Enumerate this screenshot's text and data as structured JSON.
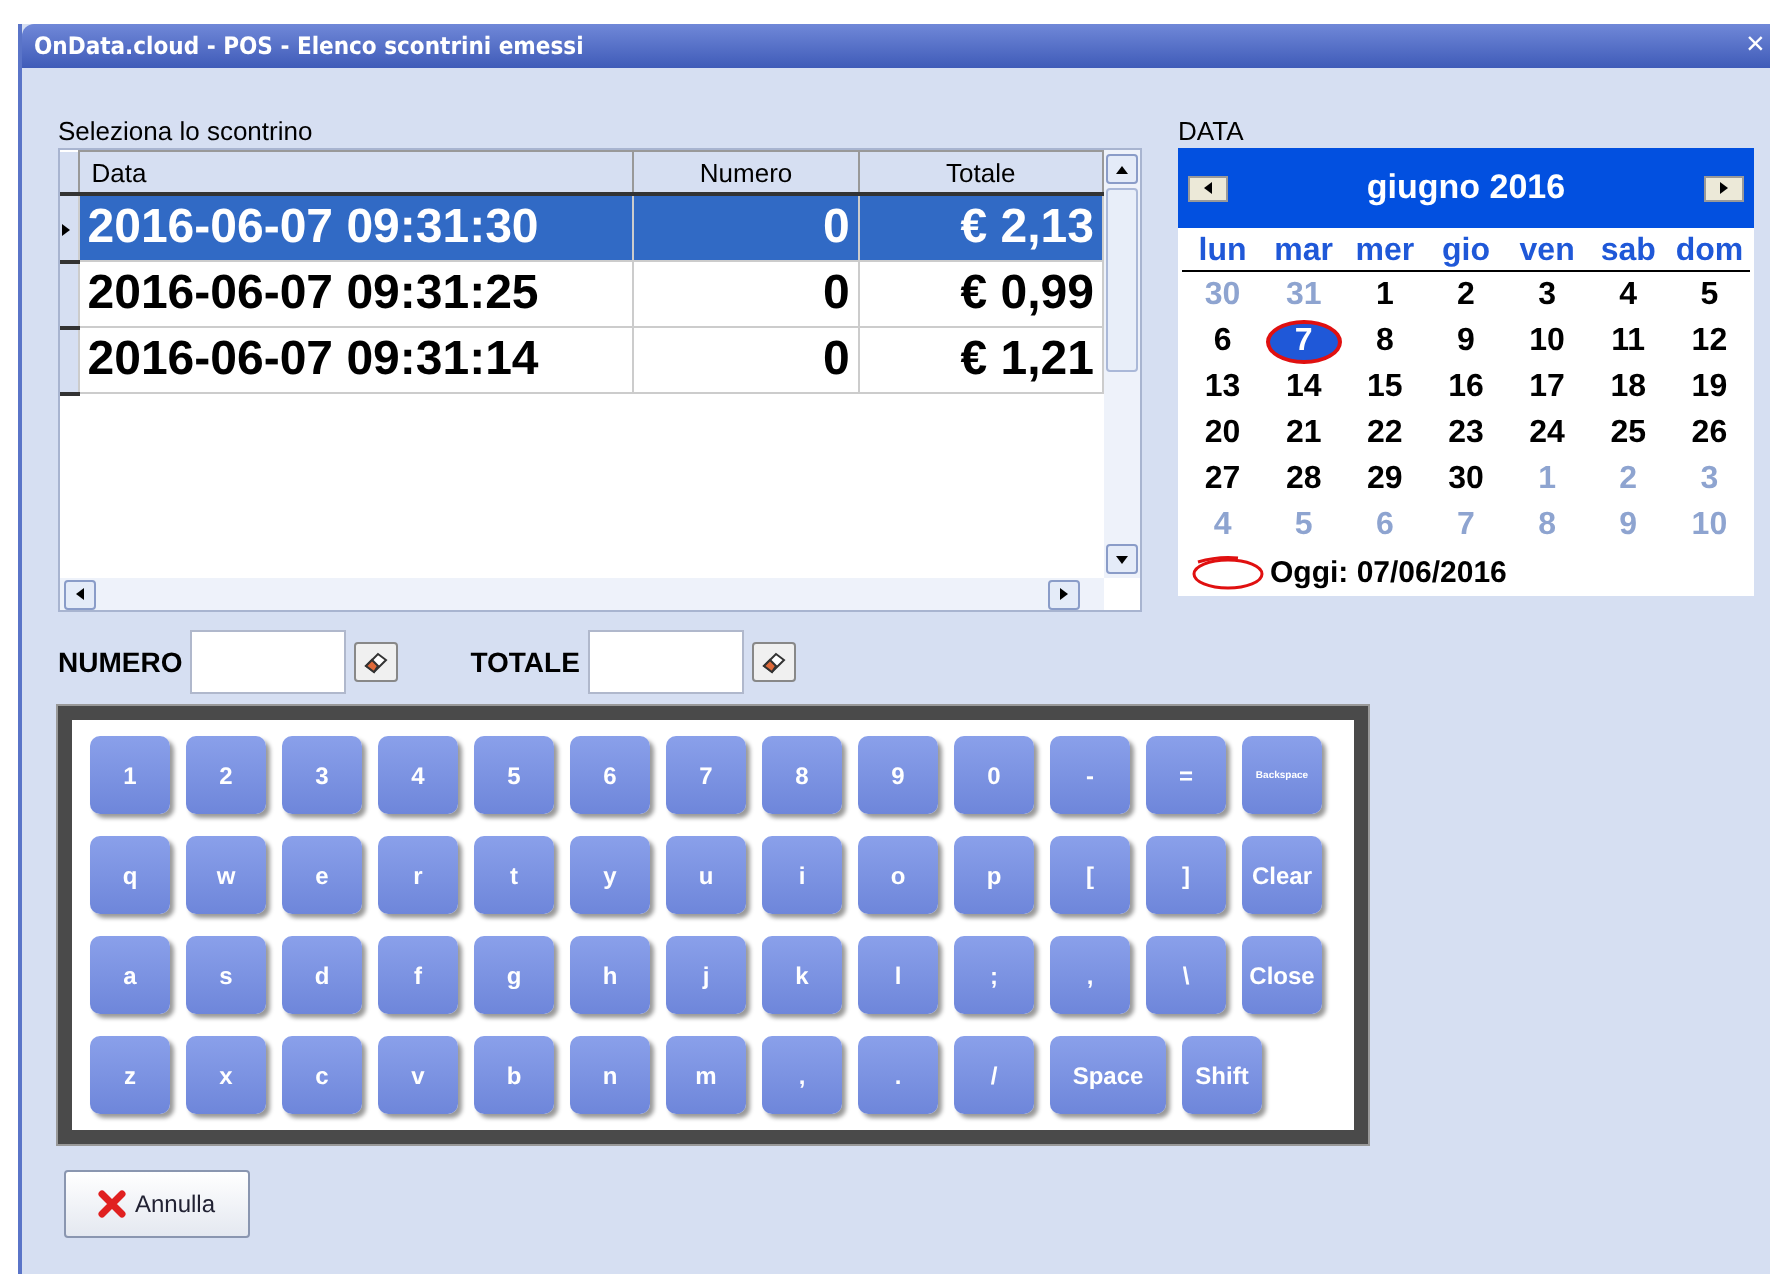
{
  "window": {
    "title": "OnData.cloud - POS - Elenco scontrini emessi",
    "close": "×"
  },
  "receipts": {
    "label": "Seleziona lo scontrino",
    "columns": [
      "Data",
      "Numero",
      "Totale"
    ],
    "rows": [
      {
        "data": "2016-06-07 09:31:30",
        "numero": "0",
        "totale": "€ 2,13",
        "selected": true
      },
      {
        "data": "2016-06-07 09:31:25",
        "numero": "0",
        "totale": "€ 0,99",
        "selected": false
      },
      {
        "data": "2016-06-07 09:31:14",
        "numero": "0",
        "totale": "€ 1,21",
        "selected": false
      }
    ]
  },
  "calendar": {
    "label": "DATA",
    "month": "giugno 2016",
    "weekdays": [
      "lun",
      "mar",
      "mer",
      "gio",
      "ven",
      "sab",
      "dom"
    ],
    "weeks": [
      [
        {
          "label": "30",
          "outside": true,
          "selected": false
        },
        {
          "label": "31",
          "outside": true,
          "selected": false
        },
        {
          "label": "1",
          "outside": false,
          "selected": false
        },
        {
          "label": "2",
          "outside": false,
          "selected": false
        },
        {
          "label": "3",
          "outside": false,
          "selected": false
        },
        {
          "label": "4",
          "outside": false,
          "selected": false
        },
        {
          "label": "5",
          "outside": false,
          "selected": false
        }
      ],
      [
        {
          "label": "6",
          "outside": false,
          "selected": false
        },
        {
          "label": "7",
          "outside": false,
          "selected": true
        },
        {
          "label": "8",
          "outside": false,
          "selected": false
        },
        {
          "label": "9",
          "outside": false,
          "selected": false
        },
        {
          "label": "10",
          "outside": false,
          "selected": false
        },
        {
          "label": "11",
          "outside": false,
          "selected": false
        },
        {
          "label": "12",
          "outside": false,
          "selected": false
        }
      ],
      [
        {
          "label": "13",
          "outside": false,
          "selected": false
        },
        {
          "label": "14",
          "outside": false,
          "selected": false
        },
        {
          "label": "15",
          "outside": false,
          "selected": false
        },
        {
          "label": "16",
          "outside": false,
          "selected": false
        },
        {
          "label": "17",
          "outside": false,
          "selected": false
        },
        {
          "label": "18",
          "outside": false,
          "selected": false
        },
        {
          "label": "19",
          "outside": false,
          "selected": false
        }
      ],
      [
        {
          "label": "20",
          "outside": false,
          "selected": false
        },
        {
          "label": "21",
          "outside": false,
          "selected": false
        },
        {
          "label": "22",
          "outside": false,
          "selected": false
        },
        {
          "label": "23",
          "outside": false,
          "selected": false
        },
        {
          "label": "24",
          "outside": false,
          "selected": false
        },
        {
          "label": "25",
          "outside": false,
          "selected": false
        },
        {
          "label": "26",
          "outside": false,
          "selected": false
        }
      ],
      [
        {
          "label": "27",
          "outside": false,
          "selected": false
        },
        {
          "label": "28",
          "outside": false,
          "selected": false
        },
        {
          "label": "29",
          "outside": false,
          "selected": false
        },
        {
          "label": "30",
          "outside": false,
          "selected": false
        },
        {
          "label": "1",
          "outside": true,
          "selected": false
        },
        {
          "label": "2",
          "outside": true,
          "selected": false
        },
        {
          "label": "3",
          "outside": true,
          "selected": false
        }
      ],
      [
        {
          "label": "4",
          "outside": true,
          "selected": false
        },
        {
          "label": "5",
          "outside": true,
          "selected": false
        },
        {
          "label": "6",
          "outside": true,
          "selected": false
        },
        {
          "label": "7",
          "outside": true,
          "selected": false
        },
        {
          "label": "8",
          "outside": true,
          "selected": false
        },
        {
          "label": "9",
          "outside": true,
          "selected": false
        },
        {
          "label": "10",
          "outside": true,
          "selected": false
        }
      ]
    ],
    "today": "Oggi: 07/06/2016"
  },
  "filters": [
    {
      "label": "NUMERO"
    },
    {
      "label": "TOTALE"
    }
  ],
  "keyboard": [
    [
      {
        "label": "1",
        "kind": "key"
      },
      {
        "label": "2",
        "kind": "key"
      },
      {
        "label": "3",
        "kind": "key"
      },
      {
        "label": "4",
        "kind": "key"
      },
      {
        "label": "5",
        "kind": "key"
      },
      {
        "label": "6",
        "kind": "key"
      },
      {
        "label": "7",
        "kind": "key"
      },
      {
        "label": "8",
        "kind": "key"
      },
      {
        "label": "9",
        "kind": "key"
      },
      {
        "label": "0",
        "kind": "key"
      },
      {
        "label": "-",
        "kind": "key"
      },
      {
        "label": "=",
        "kind": "key"
      },
      {
        "label": "Backspace",
        "kind": "small"
      }
    ],
    [
      {
        "label": "q",
        "kind": "key"
      },
      {
        "label": "w",
        "kind": "key"
      },
      {
        "label": "e",
        "kind": "key"
      },
      {
        "label": "r",
        "kind": "key"
      },
      {
        "label": "t",
        "kind": "key"
      },
      {
        "label": "y",
        "kind": "key"
      },
      {
        "label": "u",
        "kind": "key"
      },
      {
        "label": "i",
        "kind": "key"
      },
      {
        "label": "o",
        "kind": "key"
      },
      {
        "label": "p",
        "kind": "key"
      },
      {
        "label": "[",
        "kind": "key"
      },
      {
        "label": "]",
        "kind": "key"
      },
      {
        "label": "Clear",
        "kind": "key"
      }
    ],
    [
      {
        "label": "a",
        "kind": "key"
      },
      {
        "label": "s",
        "kind": "key"
      },
      {
        "label": "d",
        "kind": "key"
      },
      {
        "label": "f",
        "kind": "key"
      },
      {
        "label": "g",
        "kind": "key"
      },
      {
        "label": "h",
        "kind": "key"
      },
      {
        "label": "j",
        "kind": "key"
      },
      {
        "label": "k",
        "kind": "key"
      },
      {
        "label": "l",
        "kind": "key"
      },
      {
        "label": ";",
        "kind": "key"
      },
      {
        "label": ",",
        "kind": "key"
      },
      {
        "label": "\\",
        "kind": "key"
      },
      {
        "label": "Close",
        "kind": "key"
      }
    ],
    [
      {
        "label": "z",
        "kind": "key"
      },
      {
        "label": "x",
        "kind": "key"
      },
      {
        "label": "c",
        "kind": "key"
      },
      {
        "label": "v",
        "kind": "key"
      },
      {
        "label": "b",
        "kind": "key"
      },
      {
        "label": "n",
        "kind": "key"
      },
      {
        "label": "m",
        "kind": "key"
      },
      {
        "label": ",",
        "kind": "key"
      },
      {
        "label": ".",
        "kind": "key"
      },
      {
        "label": "/",
        "kind": "key"
      },
      {
        "label": "Space",
        "kind": "wide"
      },
      {
        "label": "Shift",
        "kind": "key"
      }
    ]
  ],
  "cancel": "Annulla"
}
